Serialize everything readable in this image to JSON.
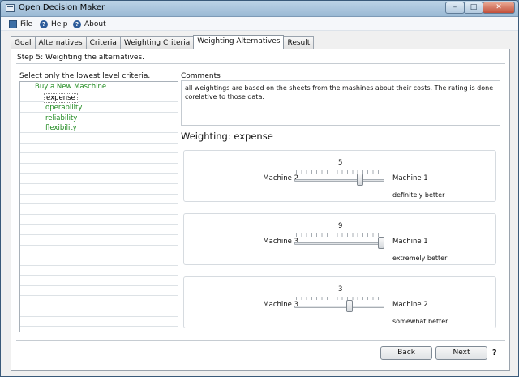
{
  "window": {
    "title": "Open Decision Maker"
  },
  "menu": {
    "file": "File",
    "help": "Help",
    "about": "About"
  },
  "tabs": [
    "Goal",
    "Alternatives",
    "Criteria",
    "Weighting Criteria",
    "Weighting Alternatives",
    "Result"
  ],
  "active_tab": "Weighting Alternatives",
  "step": "Step 5: Weighting the alternatives.",
  "tree": {
    "caption": "Select only the lowest level criteria.",
    "root": "Buy a New Maschine",
    "children": [
      "expense",
      "operability",
      "reliability",
      "flexibility"
    ],
    "selected": "expense"
  },
  "comments": {
    "label": "Comments",
    "text": "all weightings are based on the sheets from the mashines about their costs. The rating is done corelative to those data."
  },
  "weighting": {
    "title": "Weighting: expense",
    "items": [
      {
        "value": "5",
        "left": "Machine 2",
        "right": "Machine 1",
        "verdict": "definitely better",
        "level": 0.75
      },
      {
        "value": "9",
        "left": "Machine 3",
        "right": "Machine 1",
        "verdict": "extremely better",
        "level": 1.0
      },
      {
        "value": "3",
        "left": "Machine 3",
        "right": "Machine 2",
        "verdict": "somewhat better",
        "level": 0.62
      }
    ]
  },
  "buttons": {
    "back": "Back",
    "next": "Next",
    "help": "?"
  }
}
